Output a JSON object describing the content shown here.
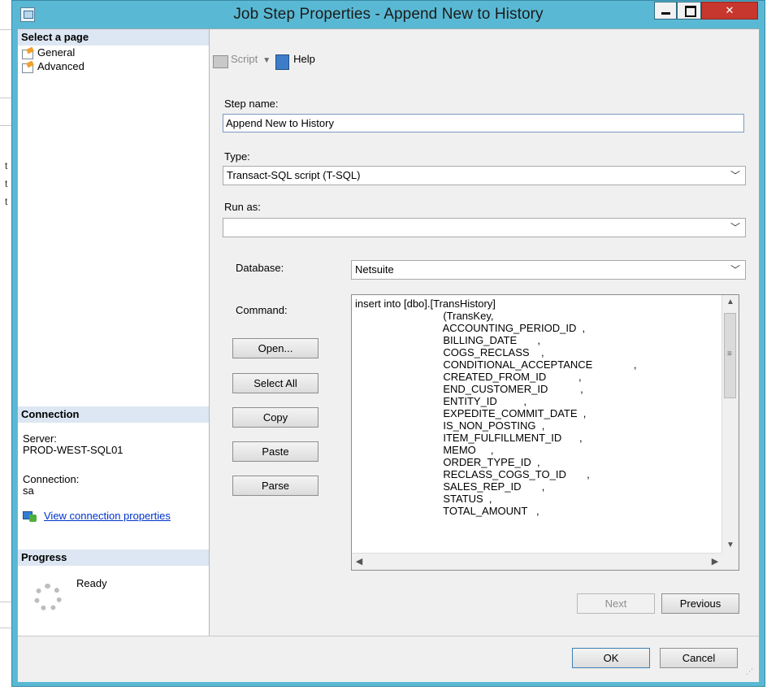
{
  "window": {
    "title": "Job Step Properties - Append New to History"
  },
  "left_pane": {
    "select_page_header": "Select a page",
    "pages": [
      {
        "label": "General",
        "icon": "page-icon"
      },
      {
        "label": "Advanced",
        "icon": "page-icon"
      }
    ],
    "connection_header": "Connection",
    "server_label": "Server:",
    "server_value": "PROD-WEST-SQL01",
    "connection_label": "Connection:",
    "connection_value": "sa",
    "view_connection_link": "View connection properties",
    "progress_header": "Progress",
    "progress_status": "Ready"
  },
  "toolbar": {
    "script_label": "Script",
    "help_label": "Help"
  },
  "form": {
    "step_name_label": "Step name:",
    "step_name_value": "Append New to History",
    "type_label": "Type:",
    "type_value": "Transact-SQL script (T-SQL)",
    "run_as_label": "Run as:",
    "run_as_value": "",
    "database_label": "Database:",
    "database_value": "Netsuite",
    "command_label": "Command:",
    "command_lines": [
      "insert into [dbo].[TransHistory]",
      "                              (TransKey,",
      "                              ACCOUNTING_PERIOD_ID  ,",
      "                              BILLING_DATE       ,",
      "                              COGS_RECLASS    ,",
      "                              CONDITIONAL_ACCEPTANCE              ,",
      "                              CREATED_FROM_ID           ,",
      "                              END_CUSTOMER_ID           ,",
      "                              ENTITY_ID         ,",
      "                              EXPEDITE_COMMIT_DATE  ,",
      "                              IS_NON_POSTING  ,",
      "                              ITEM_FULFILLMENT_ID      ,",
      "                              MEMO     ,",
      "                              ORDER_TYPE_ID  ,",
      "                              RECLASS_COGS_TO_ID       ,",
      "                              SALES_REP_ID       ,",
      "                              STATUS  ,",
      "                              TOTAL_AMOUNT   ,"
    ]
  },
  "command_buttons": {
    "open": "Open...",
    "select_all": "Select All",
    "copy": "Copy",
    "paste": "Paste",
    "parse": "Parse"
  },
  "nav_buttons": {
    "next": "Next",
    "previous": "Previous"
  },
  "dialog_buttons": {
    "ok": "OK",
    "cancel": "Cancel"
  },
  "background_fragments": [
    "t",
    "t",
    "t"
  ]
}
